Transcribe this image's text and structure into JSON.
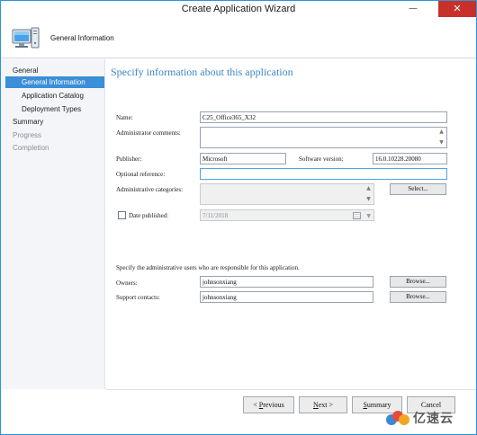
{
  "window": {
    "title": "Create Application Wizard",
    "close_glyph": "✕",
    "minimize_glyph": "—"
  },
  "header": {
    "heading": "General Information",
    "icon": "computer-wizard-icon"
  },
  "sidebar": {
    "items": [
      {
        "label": "General",
        "state": "normal"
      },
      {
        "label": "General Information",
        "state": "active"
      },
      {
        "label": "Application Catalog",
        "state": "normal"
      },
      {
        "label": "Deployment Types",
        "state": "normal"
      },
      {
        "label": "Summary",
        "state": "normal"
      },
      {
        "label": "Progress",
        "state": "disabled"
      },
      {
        "label": "Completion",
        "state": "disabled"
      }
    ]
  },
  "main": {
    "heading": "Specify information about this application",
    "name": {
      "label": "Name:",
      "value": "C25_Office365_X32"
    },
    "admin_comments": {
      "label": "Administrator comments:",
      "value": ""
    },
    "publisher": {
      "label": "Publisher:",
      "value": "Microsoft"
    },
    "software_version": {
      "label": "Software version:",
      "value": "16.0.10228.20080"
    },
    "optional_reference": {
      "label": "Optional reference:",
      "value": ""
    },
    "admin_categories": {
      "label": "Administrative categories:",
      "value": "",
      "button": "Select..."
    },
    "date_published": {
      "label": "Date published:",
      "value": "7/11/2018",
      "checked": false
    },
    "admins_section_label": "Specify the administrative users who are responsible for this application.",
    "owners": {
      "label": "Owners:",
      "value": "johnsonxiang",
      "button": "Browse..."
    },
    "support_contacts": {
      "label": "Support contacts:",
      "value": "johnsonxiang",
      "button": "Browse..."
    }
  },
  "footer": {
    "previous": {
      "prefix": "< ",
      "mnemonic": "P",
      "rest": "revious"
    },
    "next": {
      "mnemonic": "N",
      "rest": "ext >"
    },
    "summary": {
      "mnemonic": "S",
      "rest": "ummary"
    },
    "cancel": "Cancel"
  },
  "watermark": {
    "text": "亿速云"
  },
  "colors": {
    "accent": "#3b8ed8",
    "heading": "#3d86c6",
    "close": "#c7312a",
    "border": "#2b95d6"
  }
}
